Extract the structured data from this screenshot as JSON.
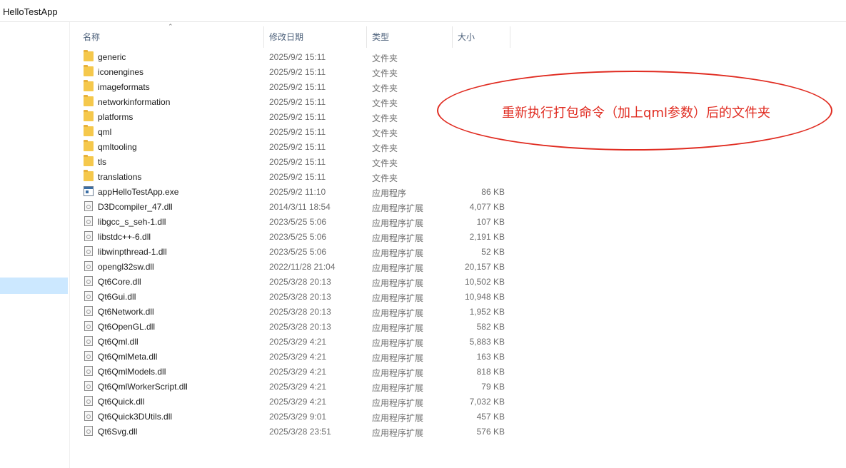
{
  "window": {
    "title": "HelloTestApp"
  },
  "columns": {
    "name": "名称",
    "modified": "修改日期",
    "type": "类型",
    "size": "大小"
  },
  "files": [
    {
      "name": "generic",
      "date": "2025/9/2 15:11",
      "type": "文件夹",
      "size": "",
      "icon": "folder-icon"
    },
    {
      "name": "iconengines",
      "date": "2025/9/2 15:11",
      "type": "文件夹",
      "size": "",
      "icon": "folder-icon"
    },
    {
      "name": "imageformats",
      "date": "2025/9/2 15:11",
      "type": "文件夹",
      "size": "",
      "icon": "folder-icon"
    },
    {
      "name": "networkinformation",
      "date": "2025/9/2 15:11",
      "type": "文件夹",
      "size": "",
      "icon": "folder-icon"
    },
    {
      "name": "platforms",
      "date": "2025/9/2 15:11",
      "type": "文件夹",
      "size": "",
      "icon": "folder-icon"
    },
    {
      "name": "qml",
      "date": "2025/9/2 15:11",
      "type": "文件夹",
      "size": "",
      "icon": "folder-icon"
    },
    {
      "name": "qmltooling",
      "date": "2025/9/2 15:11",
      "type": "文件夹",
      "size": "",
      "icon": "folder-icon"
    },
    {
      "name": "tls",
      "date": "2025/9/2 15:11",
      "type": "文件夹",
      "size": "",
      "icon": "folder-icon"
    },
    {
      "name": "translations",
      "date": "2025/9/2 15:11",
      "type": "文件夹",
      "size": "",
      "icon": "folder-icon"
    },
    {
      "name": "appHelloTestApp.exe",
      "date": "2025/9/2 11:10",
      "type": "应用程序",
      "size": "86 KB",
      "icon": "exe-icon"
    },
    {
      "name": "D3Dcompiler_47.dll",
      "date": "2014/3/11 18:54",
      "type": "应用程序扩展",
      "size": "4,077 KB",
      "icon": "dll-icon"
    },
    {
      "name": "libgcc_s_seh-1.dll",
      "date": "2023/5/25 5:06",
      "type": "应用程序扩展",
      "size": "107 KB",
      "icon": "dll-icon"
    },
    {
      "name": "libstdc++-6.dll",
      "date": "2023/5/25 5:06",
      "type": "应用程序扩展",
      "size": "2,191 KB",
      "icon": "dll-icon"
    },
    {
      "name": "libwinpthread-1.dll",
      "date": "2023/5/25 5:06",
      "type": "应用程序扩展",
      "size": "52 KB",
      "icon": "dll-icon"
    },
    {
      "name": "opengl32sw.dll",
      "date": "2022/11/28 21:04",
      "type": "应用程序扩展",
      "size": "20,157 KB",
      "icon": "dll-icon"
    },
    {
      "name": "Qt6Core.dll",
      "date": "2025/3/28 20:13",
      "type": "应用程序扩展",
      "size": "10,502 KB",
      "icon": "dll-icon"
    },
    {
      "name": "Qt6Gui.dll",
      "date": "2025/3/28 20:13",
      "type": "应用程序扩展",
      "size": "10,948 KB",
      "icon": "dll-icon"
    },
    {
      "name": "Qt6Network.dll",
      "date": "2025/3/28 20:13",
      "type": "应用程序扩展",
      "size": "1,952 KB",
      "icon": "dll-icon"
    },
    {
      "name": "Qt6OpenGL.dll",
      "date": "2025/3/28 20:13",
      "type": "应用程序扩展",
      "size": "582 KB",
      "icon": "dll-icon"
    },
    {
      "name": "Qt6Qml.dll",
      "date": "2025/3/29 4:21",
      "type": "应用程序扩展",
      "size": "5,883 KB",
      "icon": "dll-icon"
    },
    {
      "name": "Qt6QmlMeta.dll",
      "date": "2025/3/29 4:21",
      "type": "应用程序扩展",
      "size": "163 KB",
      "icon": "dll-icon"
    },
    {
      "name": "Qt6QmlModels.dll",
      "date": "2025/3/29 4:21",
      "type": "应用程序扩展",
      "size": "818 KB",
      "icon": "dll-icon"
    },
    {
      "name": "Qt6QmlWorkerScript.dll",
      "date": "2025/3/29 4:21",
      "type": "应用程序扩展",
      "size": "79 KB",
      "icon": "dll-icon"
    },
    {
      "name": "Qt6Quick.dll",
      "date": "2025/3/29 4:21",
      "type": "应用程序扩展",
      "size": "7,032 KB",
      "icon": "dll-icon"
    },
    {
      "name": "Qt6Quick3DUtils.dll",
      "date": "2025/3/29 9:01",
      "type": "应用程序扩展",
      "size": "457 KB",
      "icon": "dll-icon"
    },
    {
      "name": "Qt6Svg.dll",
      "date": "2025/3/28 23:51",
      "type": "应用程序扩展",
      "size": "576 KB",
      "icon": "dll-icon"
    }
  ],
  "annotation": {
    "text": "重新执行打包命令（加上qml参数）后的文件夹",
    "color": "#e02b20"
  },
  "colors": {
    "selection": "#cce8ff",
    "folder": "#f5c84c",
    "header_text": "#4c607a"
  }
}
